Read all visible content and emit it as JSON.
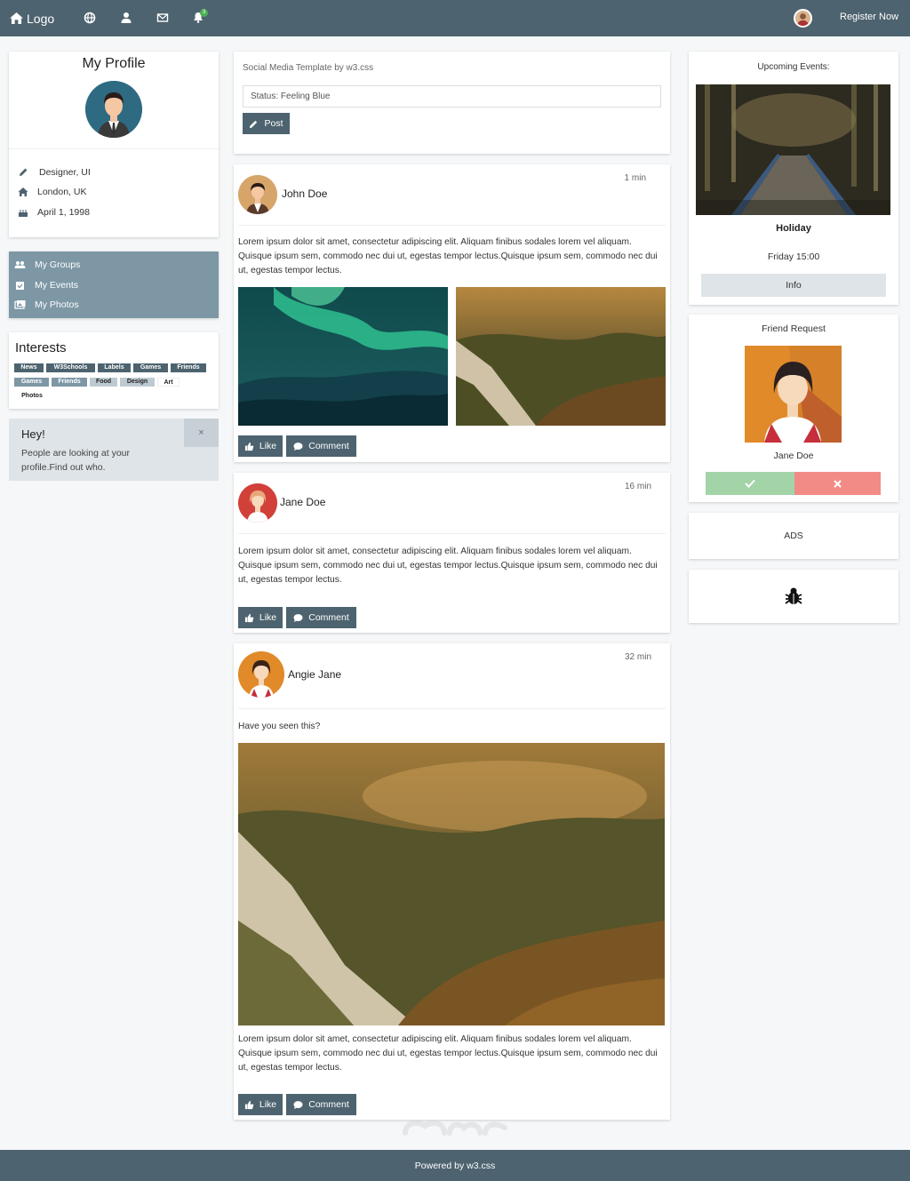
{
  "nav": {
    "logo_label": "Logo",
    "notification_count": "3",
    "register_label": "Register Now"
  },
  "profile": {
    "title": "My Profile",
    "job": "Designer, UI",
    "location": "London, UK",
    "birthday": "April 1, 1998"
  },
  "menu": {
    "groups": "My Groups",
    "events": "My Events",
    "photos": "My Photos"
  },
  "interests": {
    "title": "Interests",
    "tags": [
      "News",
      "W3Schools",
      "Labels",
      "Games",
      "Friends",
      "Games",
      "Friends",
      "Food",
      "Design",
      "Art",
      "Photos"
    ]
  },
  "alert": {
    "title": "Hey!",
    "text": "People are looking at your profile.Find out who.",
    "close": "×"
  },
  "status": {
    "template_label": "Social Media Template by w3.css",
    "input_value": "Status: Feeling Blue",
    "post_label": "Post"
  },
  "posts": [
    {
      "name": "John Doe",
      "time": "1 min",
      "text": "Lorem ipsum dolor sit amet, consectetur adipiscing elit. Aliquam finibus sodales lorem vel aliquam. Quisque ipsum sem, commodo nec dui ut, egestas tempor lectus.Quisque ipsum sem, commodo nec dui ut, egestas tempor lectus.",
      "like_label": "Like",
      "comment_label": "Comment"
    },
    {
      "name": "Jane Doe",
      "time": "16 min",
      "text": "Lorem ipsum dolor sit amet, consectetur adipiscing elit. Aliquam finibus sodales lorem vel aliquam. Quisque ipsum sem, commodo nec dui ut, egestas tempor lectus.Quisque ipsum sem, commodo nec dui ut, egestas tempor lectus.",
      "like_label": "Like",
      "comment_label": "Comment"
    },
    {
      "name": "Angie Jane",
      "time": "32 min",
      "intro": "Have you seen this?",
      "text": "Lorem ipsum dolor sit amet, consectetur adipiscing elit. Aliquam finibus sodales lorem vel aliquam. Quisque ipsum sem, commodo nec dui ut, egestas tempor lectus.Quisque ipsum sem, commodo nec dui ut, egestas tempor lectus.",
      "like_label": "Like",
      "comment_label": "Comment"
    }
  ],
  "events": {
    "title": "Upcoming Events:",
    "name": "Holiday",
    "when": "Friday 15:00",
    "info_label": "Info"
  },
  "friend_request": {
    "title": "Friend Request",
    "name": "Jane Doe"
  },
  "ads": {
    "label": "ADS"
  },
  "footer": {
    "text": "Powered by w3.css"
  },
  "colors": {
    "theme_dark": "#4d636f",
    "theme_mid": "#7d97a5",
    "theme_light": "#dfe4e8",
    "accept": "#a3d4a8",
    "decline": "#f28b85"
  }
}
